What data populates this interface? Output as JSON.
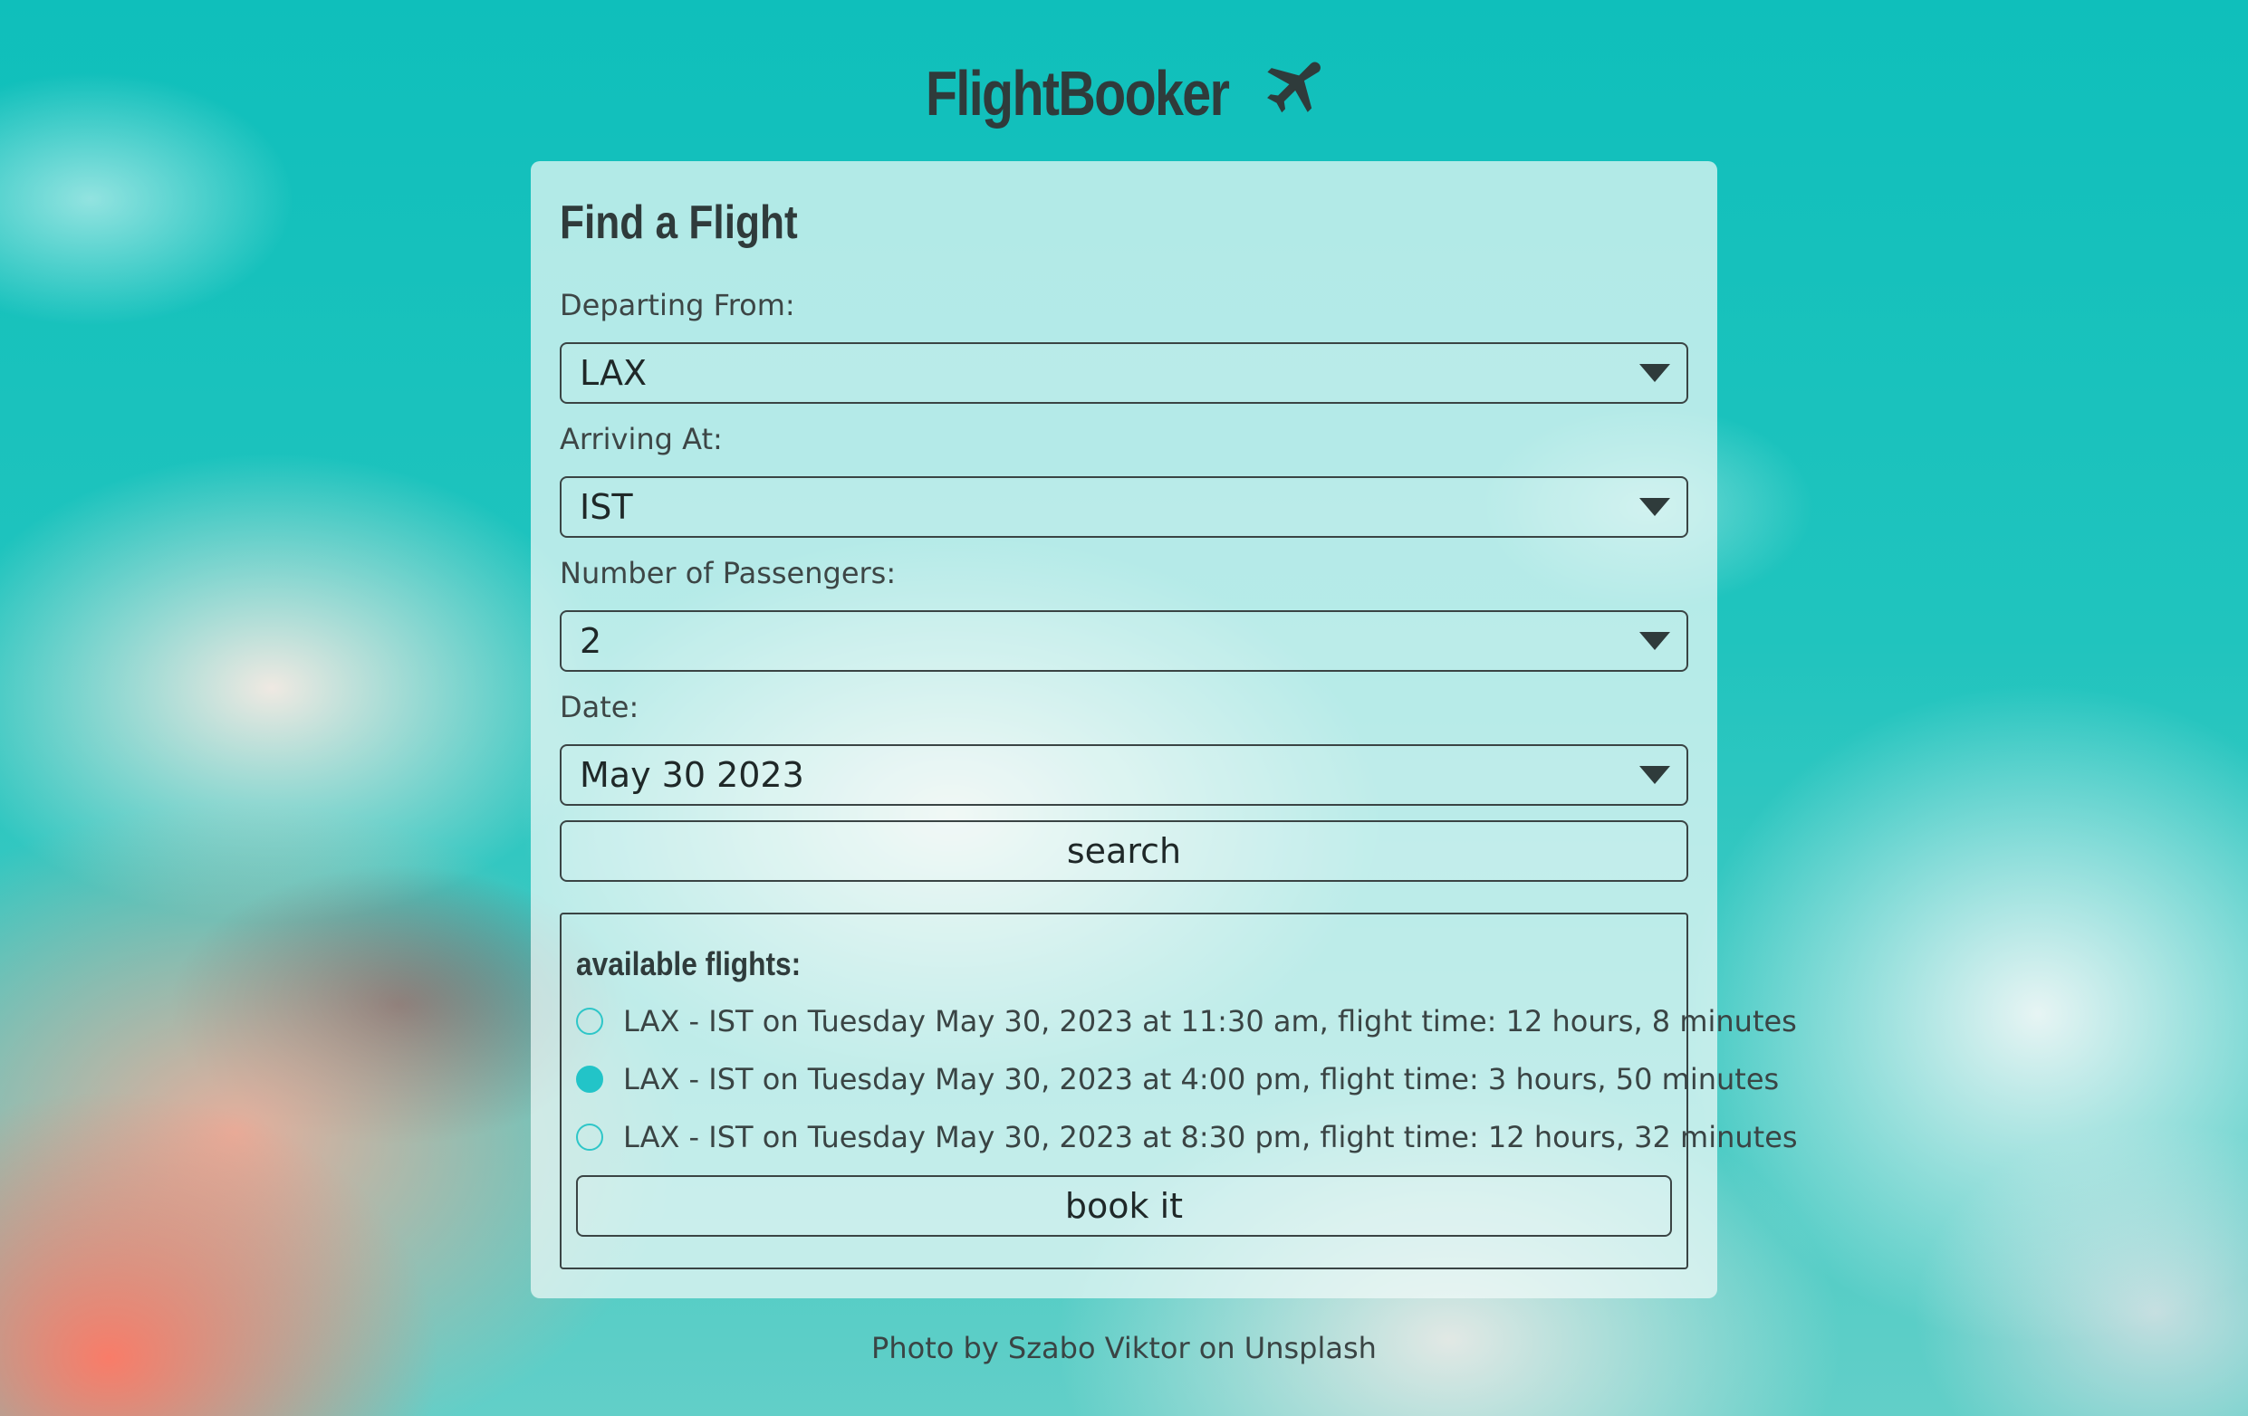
{
  "header": {
    "brand": "FlightBooker",
    "brand_icon": "airplane-icon"
  },
  "form": {
    "title": "Find a Flight",
    "departing_label": "Departing From:",
    "departing_value": "LAX",
    "arriving_label": "Arriving At:",
    "arriving_value": "IST",
    "passengers_label": "Number of Passengers:",
    "passengers_value": "2",
    "date_label": "Date:",
    "date_value": "May 30 2023",
    "search_label": "search"
  },
  "results": {
    "title": "available flights:",
    "flights": [
      {
        "text": "LAX - IST on Tuesday May 30, 2023 at 11:30 am, flight time: 12 hours, 8 minutes",
        "selected": false
      },
      {
        "text": "LAX - IST on Tuesday May 30, 2023 at 4:00 pm, flight time: 3 hours, 50 minutes",
        "selected": true
      },
      {
        "text": "LAX - IST on Tuesday May 30, 2023 at 8:30 pm, flight time: 12 hours, 32 minutes",
        "selected": false
      }
    ],
    "book_label": "book it"
  },
  "footer": {
    "credit": "Photo by Szabo Viktor on Unsplash"
  },
  "colors": {
    "accent": "#22c4c8",
    "text": "#2f3b3b"
  }
}
